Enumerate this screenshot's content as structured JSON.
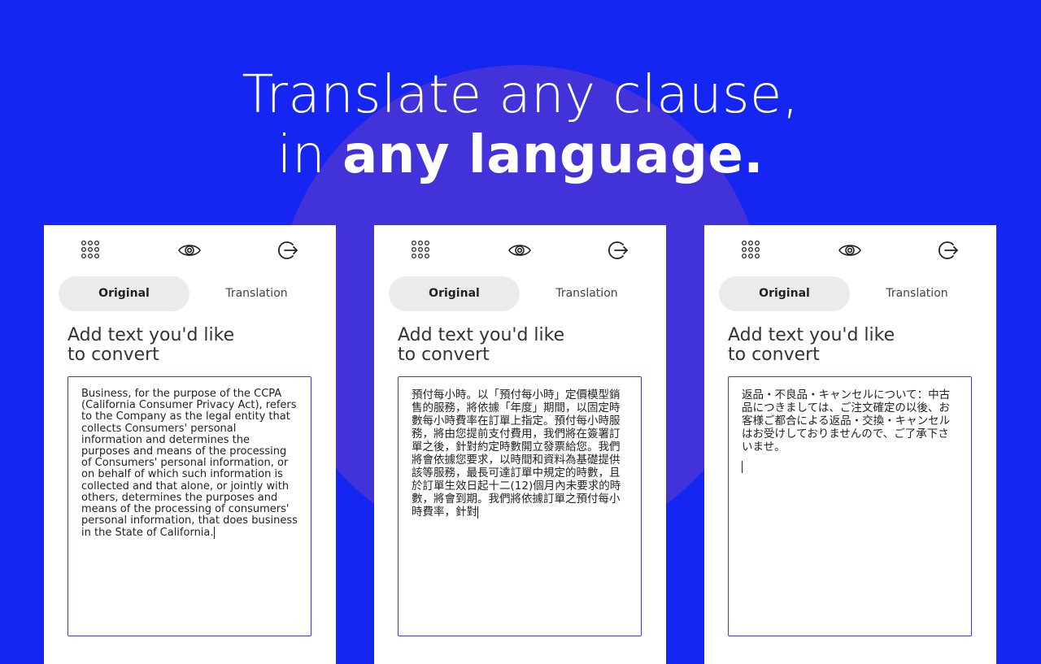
{
  "headline": {
    "line1": "Translate any clause,",
    "line2_prefix": "in ",
    "line2_bold": "any language."
  },
  "colors": {
    "background": "#1525f2",
    "circle": "#4232d9",
    "textbox_border": "#3a3ad0",
    "tab_active_bg": "#ebebeb"
  },
  "icons": [
    "grid-icon",
    "eye-icon",
    "exit-icon"
  ],
  "panels": [
    {
      "tab_original": "Original",
      "tab_translation": "Translation",
      "prompt_line1": "Add text you'd like",
      "prompt_line2": "to convert",
      "text": "Business, for the purpose of the CCPA (California Consumer Privacy Act), refers to the Company as the legal entity that collects Consumers' personal information and determines the purposes and means of the processing of Consumers' personal information, or on behalf of which such information is collected and that alone, or jointly with others, determines the purposes and means of the processing of consumers' personal information, that does business in the State of California."
    },
    {
      "tab_original": "Original",
      "tab_translation": "Translation",
      "prompt_line1": "Add text you'd like",
      "prompt_line2": "to convert",
      "text": "預付每小時。以「預付每小時」定價模型銷售的服務，將依據「年度」期間，以固定時數每小時費率在訂單上指定。預付每小時服務，將由您提前支付費用，我們將在簽署訂單之後，針對約定時數開立發票給您。我們將會依據您要求，以時間和資料為基礎提供該等服務，最長可達訂單中規定的時數，且於訂單生效日起十二(12)個月內未要求的時數，將會到期。我們將依據訂單之預付每小時費率，針對"
    },
    {
      "tab_original": "Original",
      "tab_translation": "Translation",
      "prompt_line1": "Add text you'd like",
      "prompt_line2": "to convert",
      "text": "返品・不良品・キャンセルについて：中古品につきましては、ご注文確定の以後、お客様ご都合による返品・交換・キャンセルはお受けしておりませんので、ご了承下さいませ。"
    }
  ]
}
